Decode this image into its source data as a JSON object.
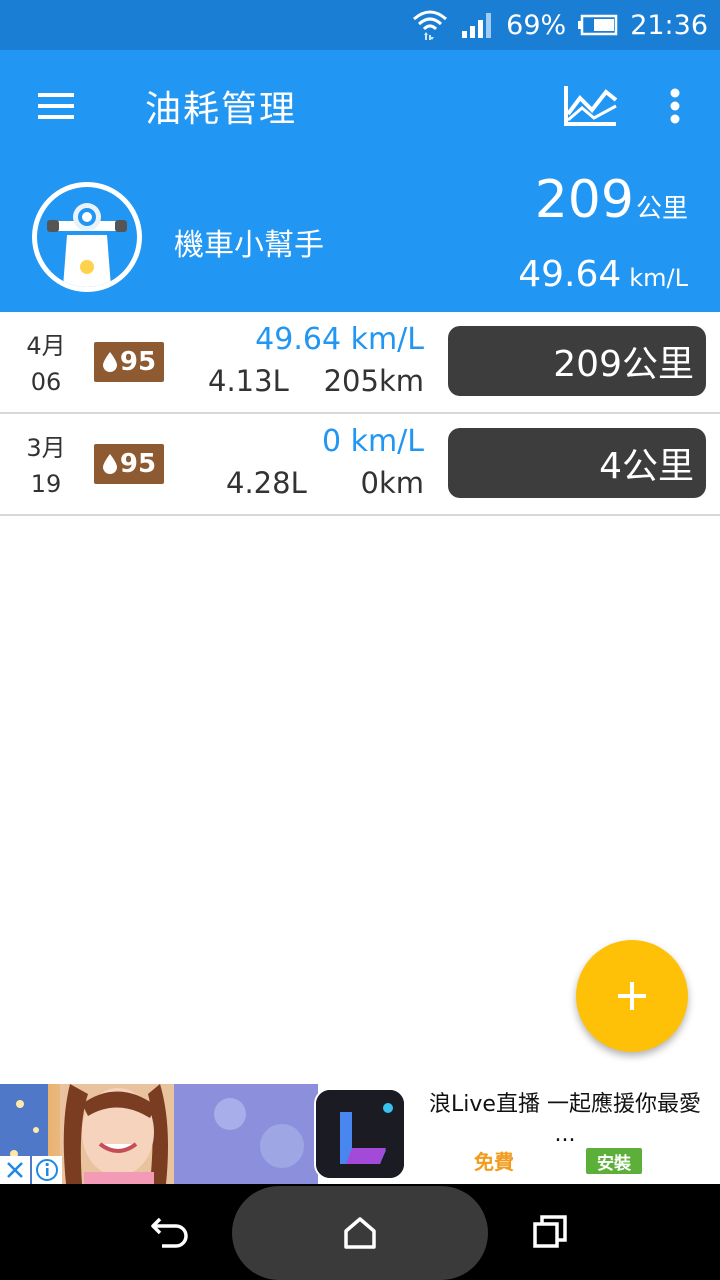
{
  "status_bar": {
    "battery": "69%",
    "time": "21:36",
    "icons": [
      "wifi-icon",
      "signal-icon",
      "battery-icon"
    ]
  },
  "app_bar": {
    "title": "油耗管理",
    "icons": [
      "menu-icon",
      "chart-icon",
      "more-vert-icon"
    ]
  },
  "summary": {
    "vehicle_name": "機車小幫手",
    "total_distance": "209",
    "total_distance_unit": "公里",
    "avg_efficiency": "49.64",
    "avg_efficiency_unit": "km/L"
  },
  "records": [
    {
      "month": "4月",
      "day": "06",
      "fuel_grade": "95",
      "efficiency": "49.64 km/L",
      "fuel": "4.13L",
      "distance": "205km",
      "odometer": "209公里"
    },
    {
      "month": "3月",
      "day": "19",
      "fuel_grade": "95",
      "efficiency": "0 km/L",
      "fuel": "4.28L",
      "distance": "0km",
      "odometer": "4公里"
    }
  ],
  "fab": {
    "icon": "plus-icon"
  },
  "ad": {
    "text": "浪Live直播 一起應援你最愛",
    "ellipsis": "...",
    "free_label": "免費",
    "install_label": "安裝"
  },
  "nav_bar": {
    "icons": [
      "back-icon",
      "home-icon",
      "recent-apps-icon"
    ]
  },
  "colors": {
    "primary": "#2196f3",
    "status_bar": "#1a7fd4",
    "fab": "#ffc107",
    "fuel_badge": "#8d5a32",
    "odometer_pill": "#3d3d3d",
    "install_button": "#5cb039"
  }
}
